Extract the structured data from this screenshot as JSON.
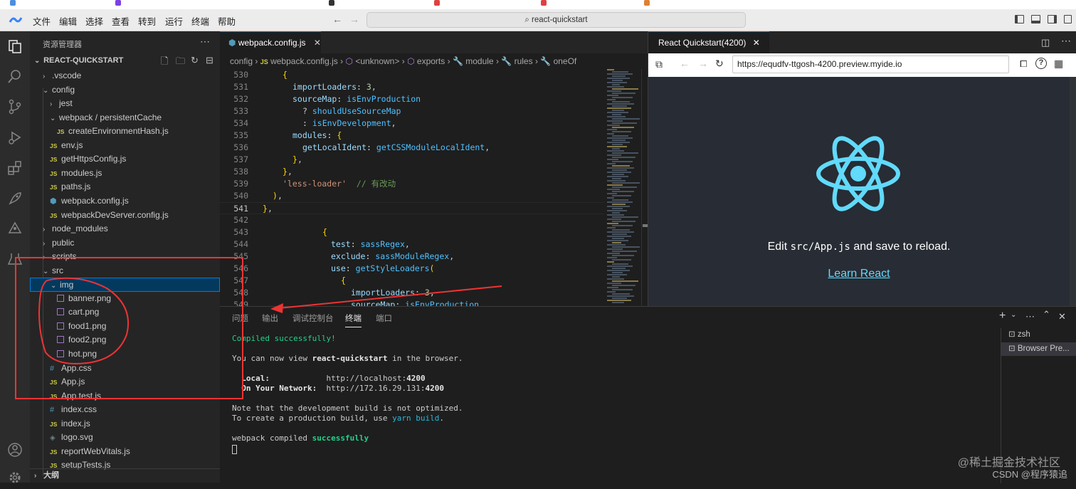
{
  "title_bar": {
    "menus": [
      "文件",
      "编辑",
      "选择",
      "查看",
      "转到",
      "运行",
      "终端",
      "帮助"
    ],
    "search": "react-quickstart"
  },
  "sidebar": {
    "header": "资源管理器",
    "project": "REACT-QUICKSTART",
    "tree": [
      {
        "label": ".vscode",
        "type": "folder",
        "expanded": false
      },
      {
        "label": "config",
        "type": "folder",
        "expanded": true
      },
      {
        "label": "jest",
        "type": "folder",
        "expanded": false
      },
      {
        "label": "webpack / persistentCache",
        "type": "folder",
        "expanded": true
      },
      {
        "label": "createEnvironmentHash.js",
        "type": "js"
      },
      {
        "label": "env.js",
        "type": "js"
      },
      {
        "label": "getHttpsConfig.js",
        "type": "js"
      },
      {
        "label": "modules.js",
        "type": "js"
      },
      {
        "label": "paths.js",
        "type": "js"
      },
      {
        "label": "webpack.config.js",
        "type": "webpack"
      },
      {
        "label": "webpackDevServer.config.js",
        "type": "js"
      },
      {
        "label": "node_modules",
        "type": "folder",
        "expanded": false
      },
      {
        "label": "public",
        "type": "folder",
        "expanded": false
      },
      {
        "label": "scripts",
        "type": "folder",
        "expanded": false
      },
      {
        "label": "src",
        "type": "folder",
        "expanded": true
      },
      {
        "label": "img",
        "type": "folder",
        "expanded": true,
        "selected": true
      },
      {
        "label": "banner.png",
        "type": "image"
      },
      {
        "label": "cart.png",
        "type": "image"
      },
      {
        "label": "food1.png",
        "type": "image"
      },
      {
        "label": "food2.png",
        "type": "image"
      },
      {
        "label": "hot.png",
        "type": "image"
      },
      {
        "label": "App.css",
        "type": "css"
      },
      {
        "label": "App.js",
        "type": "js"
      },
      {
        "label": "App.test.js",
        "type": "js"
      },
      {
        "label": "index.css",
        "type": "css"
      },
      {
        "label": "index.js",
        "type": "js"
      },
      {
        "label": "logo.svg",
        "type": "svg"
      },
      {
        "label": "reportWebVitals.js",
        "type": "js"
      },
      {
        "label": "setupTests.js",
        "type": "js"
      }
    ],
    "outline": "大纲"
  },
  "editor": {
    "tab": "webpack.config.js",
    "breadcrumb": [
      "config",
      "webpack.config.js",
      "<unknown>",
      "exports",
      "module",
      "rules",
      "oneOf"
    ],
    "lines": [
      {
        "n": "530",
        "t": "{"
      },
      {
        "n": "531",
        "t": "importLoaders: 3,"
      },
      {
        "n": "532",
        "t": "sourceMap: isEnvProduction"
      },
      {
        "n": "533",
        "t": "? shouldUseSourceMap"
      },
      {
        "n": "534",
        "t": ": isEnvDevelopment,"
      },
      {
        "n": "535",
        "t": "modules: {"
      },
      {
        "n": "536",
        "t": "getLocalIdent: getCSSModuleLocalIdent,"
      },
      {
        "n": "537",
        "t": "},"
      },
      {
        "n": "538",
        "t": "},"
      },
      {
        "n": "539",
        "t": "'less-loader'  // 有改动"
      },
      {
        "n": "540",
        "t": "),"
      },
      {
        "n": "541",
        "t": "},"
      },
      {
        "n": "542",
        "t": ""
      },
      {
        "n": "543",
        "t": "{"
      },
      {
        "n": "544",
        "t": "test: sassRegex,"
      },
      {
        "n": "545",
        "t": "exclude: sassModuleRegex,"
      },
      {
        "n": "546",
        "t": "use: getStyleLoaders("
      },
      {
        "n": "547",
        "t": "{"
      },
      {
        "n": "548",
        "t": "importLoaders: 3,"
      },
      {
        "n": "549",
        "t": "sourceMap: isEnvProduction"
      }
    ]
  },
  "preview": {
    "tab": "React Quickstart(4200)",
    "url": "https://equdfv-ttgosh-4200.preview.myide.io",
    "edit_prefix": "Edit ",
    "edit_code": "src/App.js",
    "edit_suffix": " and save to reload.",
    "link": "Learn React",
    "react_color": "#61dafb"
  },
  "panel": {
    "tabs": [
      "问题",
      "输出",
      "调试控制台",
      "终端",
      "端口"
    ],
    "active_tab": "终端",
    "terminal": {
      "compiled": "Compiled successfully!",
      "view_prefix": "You can now view ",
      "app_name": "react-quickstart",
      "view_suffix": " in the browser.",
      "local_label": "Local:",
      "local_url_prefix": "http://localhost:",
      "local_port": "4200",
      "network_label": "On Your Network:",
      "network_url_prefix": "http://172.16.29.131:",
      "network_port": "4200",
      "note1": "Note that the development build is not optimized.",
      "note2_prefix": "To create a production build, use ",
      "note2_cmd": "yarn build",
      "note2_suffix": ".",
      "webpack_prefix": "webpack compiled ",
      "webpack_status": "successfully"
    },
    "terminals": [
      "zsh",
      "Browser Pre..."
    ]
  },
  "watermark": {
    "line1": "@稀土掘金技术社区",
    "line2": "CSDN @程序猿追"
  },
  "colors": {
    "accent": "#0078d4",
    "annotation": "#ee3333"
  }
}
